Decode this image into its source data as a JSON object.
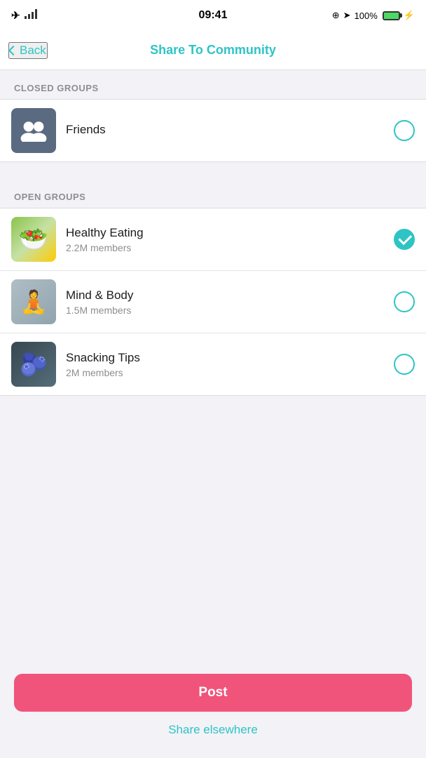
{
  "statusBar": {
    "time": "09:41",
    "battery": "100%",
    "signal": "●●●●"
  },
  "nav": {
    "backLabel": "Back",
    "title": "Share To Community"
  },
  "sections": {
    "closedGroups": {
      "label": "CLOSED GROUPS",
      "items": [
        {
          "id": "friends",
          "name": "Friends",
          "members": "",
          "selected": false,
          "avatarType": "friends"
        }
      ]
    },
    "openGroups": {
      "label": "OPEN GROUPS",
      "items": [
        {
          "id": "healthy-eating",
          "name": "Healthy Eating",
          "members": "2.2M members",
          "selected": true,
          "avatarType": "healthy-eating"
        },
        {
          "id": "mind-body",
          "name": "Mind & Body",
          "members": "1.5M members",
          "selected": false,
          "avatarType": "mind-body"
        },
        {
          "id": "snacking-tips",
          "name": "Snacking Tips",
          "members": "2M members",
          "selected": false,
          "avatarType": "snacking-tips"
        }
      ]
    }
  },
  "actions": {
    "postLabel": "Post",
    "shareElsewhereLabel": "Share elsewhere"
  },
  "colors": {
    "accent": "#2ec4c4",
    "postButton": "#f0547a"
  }
}
